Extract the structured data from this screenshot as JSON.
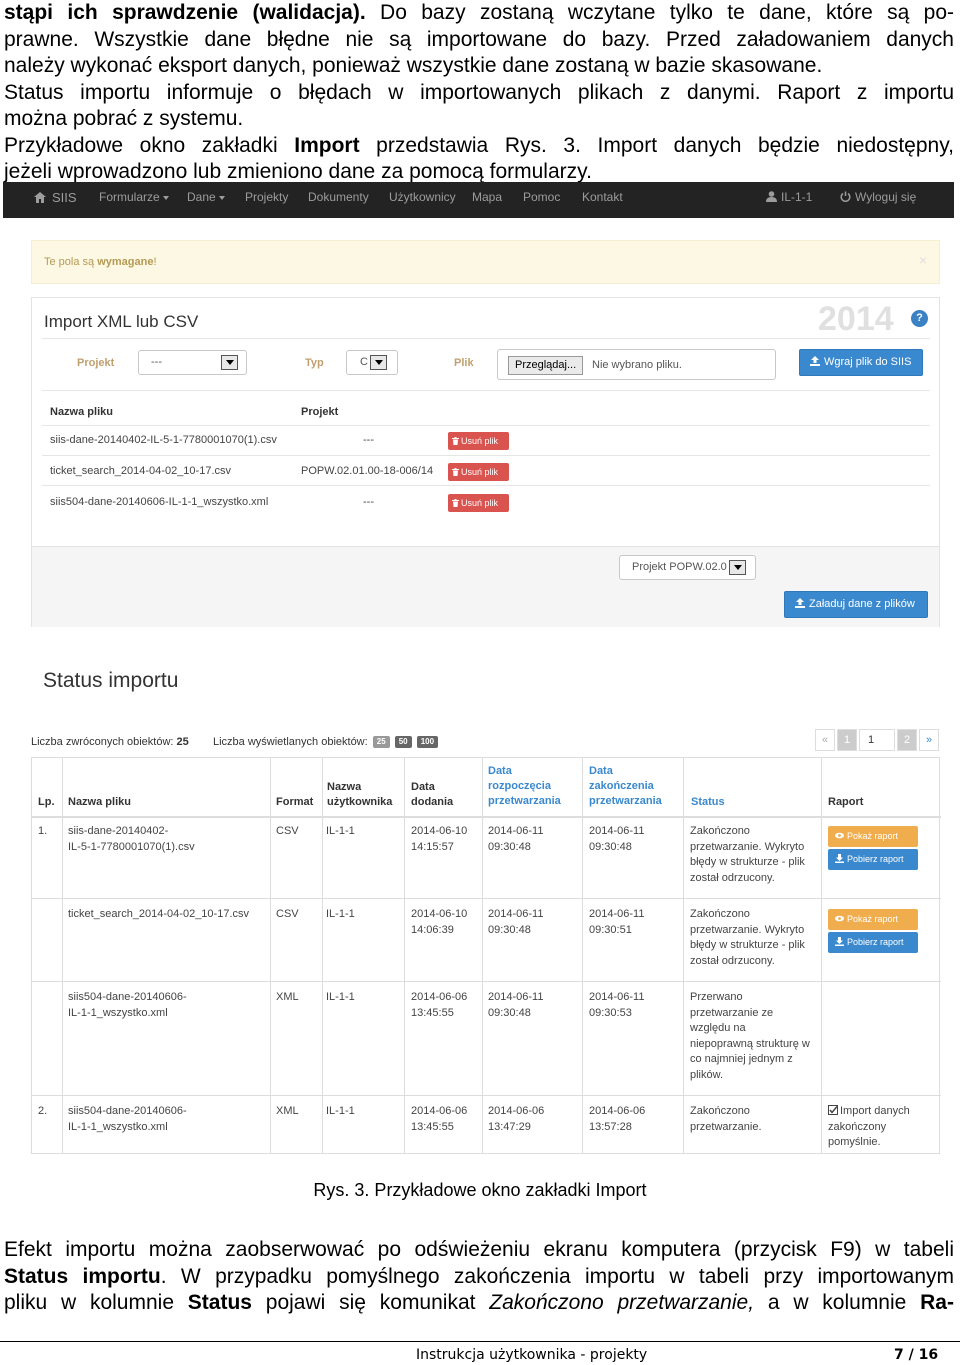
{
  "doc": {
    "top_lines": [
      {
        "bold": "stąpi ich sprawdzenie (walidacja).",
        "rest": " Do bazy zostaną wczytane tylko te dane, które są po-"
      },
      "prawne. Wszystkie dane błędne nie są importowane do bazy. Przed załadowaniem danych",
      "należy wykonać eksport danych, ponieważ wszystkie dane zostaną w bazie skasowane.",
      "Status importu informuje o błędach w importowanych plikach z danymi. Raport z importu",
      "można pobrać z systemu."
    ],
    "para2_a": "Przykładowe okno zakładki ",
    "para2_bold": "Import",
    "para2_b": " przedstawia Rys. 3. Import danych będzie niedostępny,",
    "para2_line2": "jeżeli wprowadzono lub zmieniono dane za pomocą formularzy.",
    "caption": "Rys. 3. Przykładowe okno zakładki Import",
    "bottom_line1": "Efekt importu można zaobserwować po odświeżeniu ekranu komputera (przycisk F9) w tabeli",
    "bottom_line2_bold": "Status importu",
    "bottom_line2_rest": ". W przypadku pomyślnego zakończenia importu w tabeli przy importowanym",
    "bottom_line3_a": "pliku w kolumnie ",
    "bottom_line3_b1": "Status",
    "bottom_line3_b": " pojawi się komunikat ",
    "bottom_line3_i": "Zakończono przetwarzanie,",
    "bottom_line3_c": " a w kolumnie ",
    "bottom_line3_b2": "Ra-",
    "footer_title": "Instrukcja użytkownika - projekty",
    "footer_page": "7 / 16"
  },
  "navbar": {
    "brand": "SIIS",
    "items": [
      "Formularze",
      "Dane",
      "Projekty",
      "Dokumenty",
      "Użytkownicy",
      "Mapa",
      "Pomoc",
      "Kontakt"
    ],
    "user": "IL-1-1",
    "logout": "Wyloguj się"
  },
  "alert": {
    "text_a": "Te pola są ",
    "text_bold": "wymagane",
    "text_b": "!",
    "close": "×"
  },
  "import_panel": {
    "title": "Import XML lub CSV",
    "year": "2014",
    "help": "?",
    "projekt_label": "Projekt",
    "projekt_value": "---",
    "typ_label": "Typ",
    "typ_value": "C",
    "plik_label": "Plik",
    "browse": "Przeglądaj...",
    "no_file": "Nie wybrano pliku.",
    "upload": "Wgraj plik do SIIS",
    "col_file": "Nazwa pliku",
    "col_project": "Projekt",
    "files": [
      {
        "name": "siis-dane-20140402-IL-5-1-7780001070(1).csv",
        "project": "---",
        "remove": "Usuń plik"
      },
      {
        "name": "ticket_search_2014-04-02_10-17.csv",
        "project": "POPW.02.01.00-18-006/14",
        "remove": "Usuń plik"
      },
      {
        "name": "siis504-dane-20140606-IL-1-1_wszystko.xml",
        "project": "---",
        "remove": "Usuń plik"
      }
    ],
    "footer_select": "Projekt POPW.02.0",
    "load": "Załaduj dane z plików"
  },
  "status": {
    "title": "Status importu",
    "returned_label": "Liczba zwróconych obiektów: ",
    "returned_value": "25",
    "displayed_label": "Liczba wyświetlanych obiektów:",
    "page_sizes": [
      "25",
      "50",
      "100"
    ],
    "pager": [
      "«",
      "1",
      "1",
      "2",
      "»"
    ],
    "headers": {
      "lp": "Lp.",
      "file": "Nazwa pliku",
      "format": "Format",
      "user": [
        "Nazwa",
        "użytkownika"
      ],
      "added": [
        "Data",
        "dodania"
      ],
      "start": [
        "Data",
        "rozpoczęcia",
        "przetwarzania"
      ],
      "end": [
        "Data",
        "zakończenia",
        "przetwarzania"
      ],
      "status": "Status",
      "report": "Raport"
    },
    "rows": [
      {
        "lp": "1.",
        "file": [
          "siis-dane-20140402-",
          "IL-5-1-7780001070(1).csv"
        ],
        "format": "CSV",
        "user": "IL-1-1",
        "added": [
          "2014-06-10",
          "14:15:57"
        ],
        "start": [
          "2014-06-11",
          "09:30:48"
        ],
        "end": [
          "2014-06-11",
          "09:30:48"
        ],
        "status": [
          "Zakończono",
          "przetwarzanie. Wykryto",
          "błędy w strukturze - plik",
          "został odrzucony."
        ],
        "show": "Pokaż raport",
        "download": "Pobierz raport"
      },
      {
        "lp": "",
        "file": [
          "ticket_search_2014-04-02_10-17.csv"
        ],
        "format": "CSV",
        "user": "IL-1-1",
        "added": [
          "2014-06-10",
          "14:06:39"
        ],
        "start": [
          "2014-06-11",
          "09:30:48"
        ],
        "end": [
          "2014-06-11",
          "09:30:51"
        ],
        "status": [
          "Zakończono",
          "przetwarzanie. Wykryto",
          "błędy w strukturze - plik",
          "został odrzucony."
        ],
        "show": "Pokaż raport",
        "download": "Pobierz raport"
      },
      {
        "lp": "",
        "file": [
          "siis504-dane-20140606-",
          "IL-1-1_wszystko.xml"
        ],
        "format": "XML",
        "user": "IL-1-1",
        "added": [
          "2014-06-06",
          "13:45:55"
        ],
        "start": [
          "2014-06-11",
          "09:30:48"
        ],
        "end": [
          "2014-06-11",
          "09:30:53"
        ],
        "status": [
          "Przerwano",
          "przetwarzanie ze",
          "względu na",
          "niepoprawną strukturę w",
          "co najmniej jednym z",
          "plików."
        ]
      },
      {
        "lp": "2.",
        "file": [
          "siis504-dane-20140606-",
          "IL-1-1_wszystko.xml"
        ],
        "format": "XML",
        "user": "IL-1-1",
        "added": [
          "2014-06-06",
          "13:45:55"
        ],
        "start": [
          "2014-06-06",
          "13:47:29"
        ],
        "end": [
          "2014-06-06",
          "13:57:28"
        ],
        "status": [
          "Zakończono",
          "przetwarzanie."
        ],
        "report_text": [
          "Import danych",
          "zakończony",
          "pomyślnie."
        ]
      }
    ]
  },
  "colors": {
    "navbar": "#232323",
    "primary": "#3a89ce",
    "danger": "#d9534f",
    "warning": "#f0ad4e",
    "alert_bg": "#fcf8e3"
  }
}
